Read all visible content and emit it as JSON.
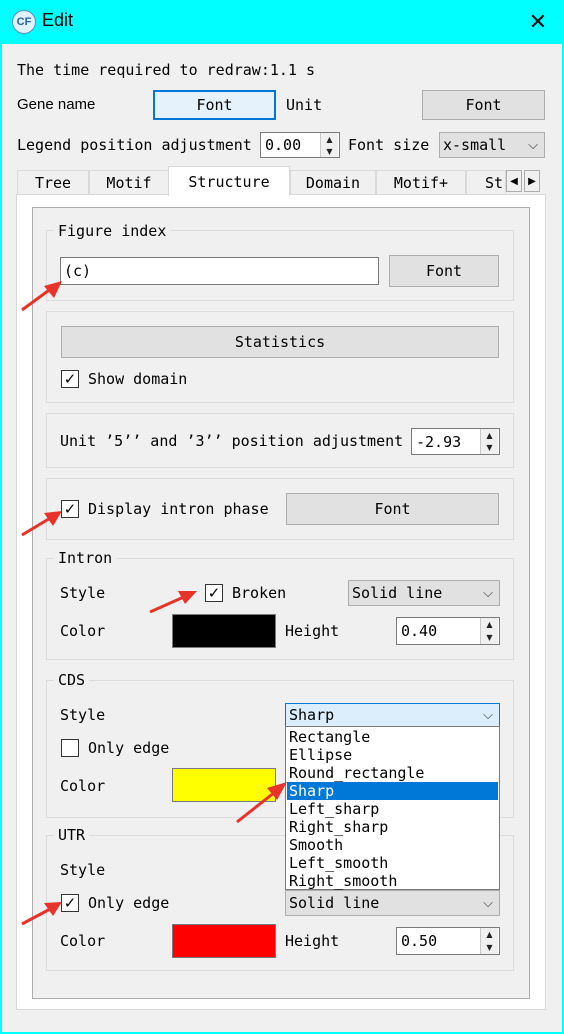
{
  "window": {
    "title": "Edit",
    "icon": "cf-app-icon",
    "close": "✕"
  },
  "redraw_time_text": "The time required to redraw:1.1 s",
  "gene_name": {
    "label": "Gene name",
    "font_button": "Font"
  },
  "unit": {
    "label": "Unit",
    "font_button": "Font"
  },
  "legend": {
    "label": "Legend position adjustment",
    "value": "0.00"
  },
  "font_size": {
    "label": "Font size",
    "value": "x-small"
  },
  "tabs": [
    {
      "label": "Tree"
    },
    {
      "label": "Motif"
    },
    {
      "label": "Structure",
      "active": true
    },
    {
      "label": "Domain"
    },
    {
      "label": "Motif+"
    },
    {
      "label": "St"
    }
  ],
  "tab_scroll": {
    "left": "◀",
    "right": "▶"
  },
  "figure_index": {
    "label": "Figure index",
    "value": "(c)",
    "font_button": "Font"
  },
  "statistics": {
    "button": "Statistics",
    "show_domain_label": "Show domain",
    "show_domain_checked": true
  },
  "unit_adjust": {
    "label": "Unit ’5’’ and ’3’’ position adjustment",
    "value": "-2.93"
  },
  "intron_phase": {
    "label": "Display intron phase",
    "checked": true,
    "font_button": "Font"
  },
  "intron": {
    "title": "Intron",
    "style_label": "Style",
    "broken_label": "Broken",
    "broken_checked": true,
    "line_value": "Solid line",
    "color_label": "Color",
    "color": "#000000",
    "height_label": "Height",
    "height_value": "0.40"
  },
  "cds": {
    "title": "CDS",
    "style_label": "Style",
    "style_value": "Sharp",
    "only_edge_label": "Only edge",
    "only_edge_checked": false,
    "color_label": "Color",
    "color": "#ffff00",
    "options": [
      "Rectangle",
      "Ellipse",
      "Round_rectangle",
      "Sharp",
      "Left_sharp",
      "Right_sharp",
      "Smooth",
      "Left_smooth",
      "Right_smooth"
    ],
    "selected_option": "Sharp"
  },
  "utr": {
    "title": "UTR",
    "style_label": "Style",
    "only_edge_label": "Only edge",
    "only_edge_checked": true,
    "line_value": "Solid line",
    "color_label": "Color",
    "color": "#ff0000",
    "height_label": "Height",
    "height_value": "0.50"
  },
  "check_mark": "✓",
  "spin_up": "▲",
  "spin_down": "▼",
  "chevron": "⌵",
  "annotation_color": "#e8332a"
}
